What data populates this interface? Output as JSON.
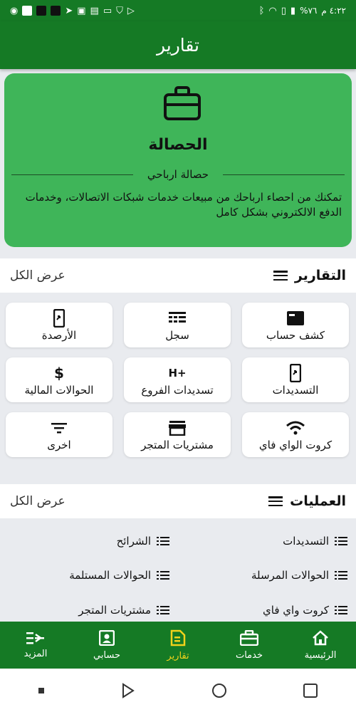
{
  "status_bar": {
    "time": "٤:٢٢ م",
    "battery": "%٧٦"
  },
  "app_bar": {
    "title": "تقارير"
  },
  "hero_card": {
    "title": "الحصالة",
    "subtitle": "حصالة ارباحي",
    "description": "تمكنك من احصاء ارباحك من مبيعات خدمات شبكات الاتصالات، وخدمات الدفع الالكتروني بشكل كامل"
  },
  "reports_section": {
    "title": "التقارير",
    "view_all": "عرض الكل",
    "items": [
      {
        "label": "كشف حساب",
        "icon": "statement-icon"
      },
      {
        "label": "سجل",
        "icon": "ledger-icon"
      },
      {
        "label": "الأرصدة",
        "icon": "balances-phone-icon"
      },
      {
        "label": "التسديدات",
        "icon": "payments-phone-icon"
      },
      {
        "label": "تسديدات الفروع",
        "icon": "branch-payments-icon"
      },
      {
        "label": "الحوالات المالية",
        "icon": "money-transfer-icon"
      },
      {
        "label": "كروت الواي فاي",
        "icon": "wifi-icon"
      },
      {
        "label": "مشتريات المتجر",
        "icon": "store-icon"
      },
      {
        "label": "اخرى",
        "icon": "filter-icon"
      }
    ]
  },
  "operations_section": {
    "title": "العمليات",
    "view_all": "عرض الكل",
    "items": [
      {
        "label": "التسديدات"
      },
      {
        "label": "الشرائح"
      },
      {
        "label": "الحوالات المرسلة"
      },
      {
        "label": "الحوالات المستلمة"
      },
      {
        "label": "كروت واي فاي"
      },
      {
        "label": "مشتريات المتجر"
      }
    ]
  },
  "bottom_nav": {
    "items": [
      {
        "label": "الرئيسية",
        "icon": "home-icon"
      },
      {
        "label": "خدمات",
        "icon": "toolbox-icon"
      },
      {
        "label": "تقارير",
        "icon": "report-icon",
        "active": true
      },
      {
        "label": "حسابي",
        "icon": "account-icon"
      },
      {
        "label": "المزيد",
        "icon": "more-icon"
      }
    ]
  },
  "colors": {
    "primary_green": "#157a25",
    "card_green": "#3fb559",
    "active_nav": "#f2d21b"
  }
}
